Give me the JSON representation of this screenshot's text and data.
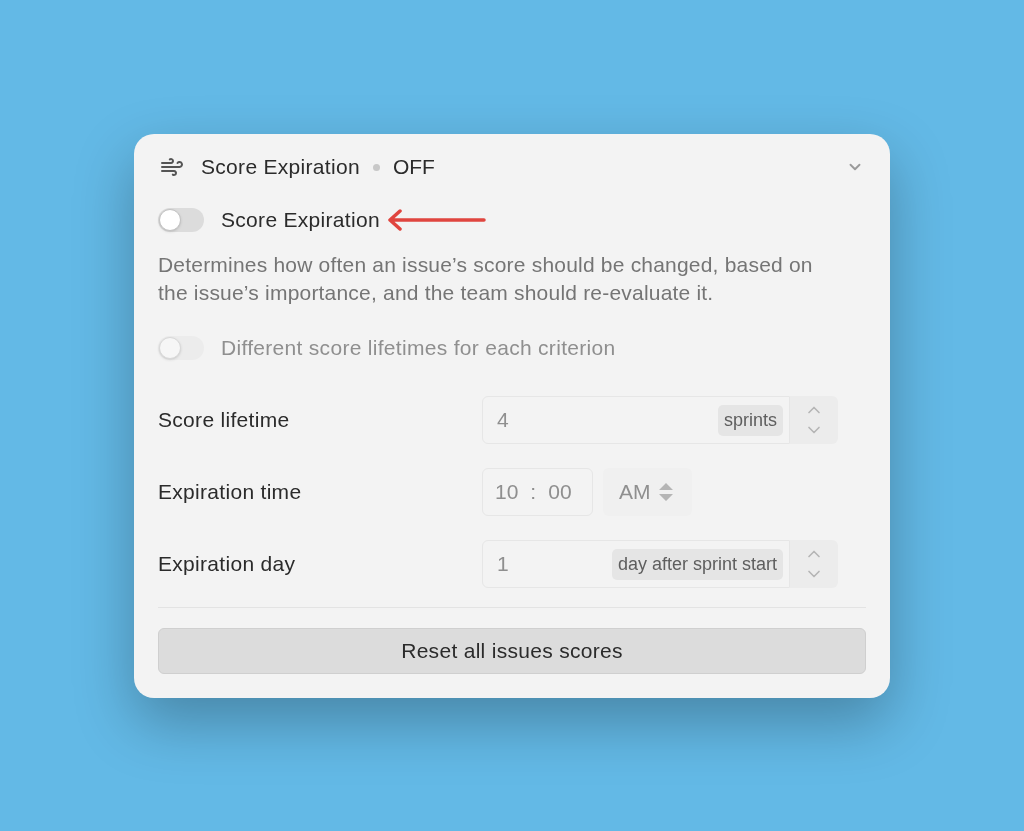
{
  "panel": {
    "title": "Score Expiration",
    "status": "OFF"
  },
  "main_toggle": {
    "label": "Score Expiration",
    "on": false,
    "disabled": false
  },
  "description": "Determines how often an issue’s score should be changed, based on the issue’s importance, and the team should re-evaluate it.",
  "criterion_toggle": {
    "label": "Different score lifetimes for each criterion",
    "on": false,
    "disabled": true
  },
  "settings": [
    {
      "kind": "stepper",
      "label": "Score lifetime",
      "value": "4",
      "unit": "sprints",
      "disabled": true
    },
    {
      "kind": "time",
      "label": "Expiration time",
      "hour": "10",
      "separator": ":",
      "minute": "00",
      "period": "AM",
      "disabled": true
    },
    {
      "kind": "stepper",
      "label": "Expiration day",
      "value": "1",
      "unit": "day after sprint start",
      "disabled": true
    }
  ],
  "button": {
    "label": "Reset all issues scores"
  }
}
